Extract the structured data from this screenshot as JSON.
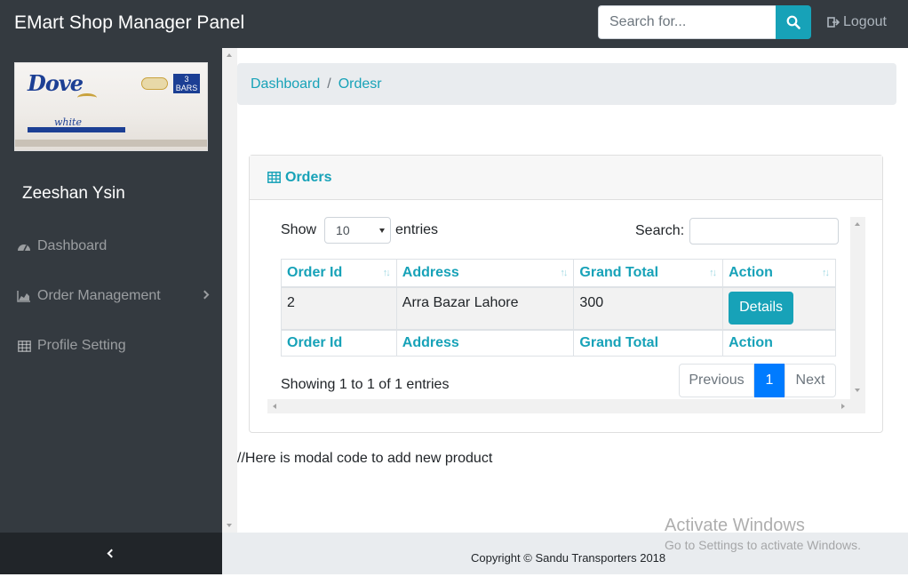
{
  "header": {
    "brand": "EMart Shop Manager Panel",
    "search_placeholder": "Search for...",
    "logout_label": "Logout"
  },
  "sidebar": {
    "product_image_brand": "Dove",
    "product_image_variant": "white",
    "product_image_badge": "3 BARS",
    "user_name": "Zeeshan Ysin",
    "items": [
      {
        "label": "Dashboard",
        "icon": "tachometer-icon"
      },
      {
        "label": "Order Management",
        "icon": "area-chart-icon"
      },
      {
        "label": "Profile Setting",
        "icon": "table-icon"
      }
    ]
  },
  "breadcrumb": {
    "items": [
      "Dashboard",
      "Ordesr"
    ],
    "separator": "/"
  },
  "orders_card": {
    "title": "Orders",
    "length_prefix": "Show",
    "length_value": "10",
    "length_suffix": "entries",
    "search_label": "Search:",
    "columns": [
      "Order Id",
      "Address",
      "Grand Total",
      "Action"
    ],
    "rows": [
      {
        "order_id": "2",
        "address": "Arra Bazar Lahore",
        "grand_total": "300",
        "action": "Details"
      }
    ],
    "info": "Showing 1 to 1 of 1 entries",
    "pagination": {
      "previous": "Previous",
      "current": "1",
      "next": "Next"
    }
  },
  "modal_note": "//Here is modal code to add new product",
  "footer": {
    "copyright": "Copyright © Sandu Transporters 2018"
  },
  "windows_watermark": {
    "line1": "Activate Windows",
    "line2": "Go to Settings to activate Windows."
  },
  "colors": {
    "topbar": "#343a40",
    "accent": "#17a2b8",
    "pagination_active": "#007bff",
    "breadcrumb_bg": "#e9ecef"
  }
}
